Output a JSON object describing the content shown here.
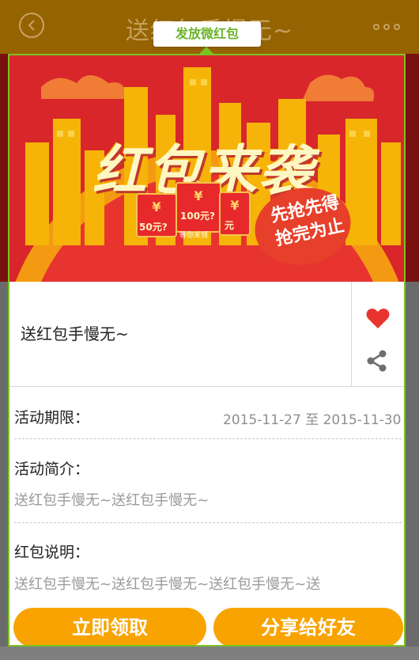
{
  "header": {
    "title": "送红包手慢无~"
  },
  "tooltip": {
    "label": "发放微红包"
  },
  "banner": {
    "headline": "红包来袭",
    "badge_line1": "先抢先得",
    "badge_line2": "抢完为止",
    "envelopes": [
      {
        "symbol": "¥",
        "amount": "50元?"
      },
      {
        "symbol": "¥",
        "amount": "100元?"
      },
      {
        "symbol": "¥",
        "amount": "元"
      }
    ],
    "caption": "等你来领"
  },
  "activity": {
    "title": "送红包手慢无~"
  },
  "info": {
    "period_label": "活动期限：",
    "period_start": "2015-11-27",
    "period_sep": "至",
    "period_end": "2015-11-30",
    "intro_label": "活动简介：",
    "intro_text": "送红包手慢无~送红包手慢无~",
    "desc_label": "红包说明：",
    "desc_text": "送红包手慢无~送红包手慢无~送红包手慢无~送"
  },
  "actions": {
    "claim_label": "立即领取",
    "share_label": "分享给好友"
  },
  "colors": {
    "accent": "#f8a300",
    "highlight": "#7cc321",
    "heart": "#e8342f",
    "banner_red": "#d8262b"
  },
  "icons": {
    "back": "back-icon",
    "more": "more-icon",
    "favorite": "heart-icon",
    "share": "share-icon"
  }
}
